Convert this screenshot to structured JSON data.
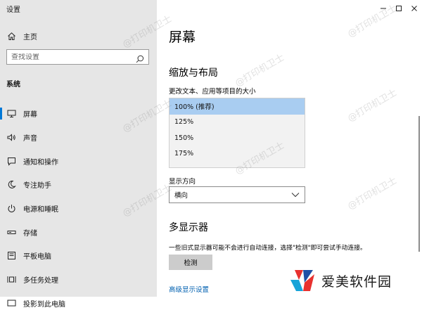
{
  "app_title": "设置",
  "sidebar": {
    "home_label": "主页",
    "search_placeholder": "查找设置",
    "section_label": "系统",
    "items": [
      {
        "label": "屏幕",
        "icon": "monitor-icon",
        "active": true
      },
      {
        "label": "声音",
        "icon": "speaker-icon",
        "active": false
      },
      {
        "label": "通知和操作",
        "icon": "notification-icon",
        "active": false
      },
      {
        "label": "专注助手",
        "icon": "moon-icon",
        "active": false
      },
      {
        "label": "电源和睡眠",
        "icon": "power-icon",
        "active": false
      },
      {
        "label": "存储",
        "icon": "storage-icon",
        "active": false
      },
      {
        "label": "平板电脑",
        "icon": "tablet-icon",
        "active": false
      },
      {
        "label": "多任务处理",
        "icon": "multitask-icon",
        "active": false
      },
      {
        "label": "投影到此电脑",
        "icon": "project-icon",
        "active": false
      }
    ]
  },
  "main": {
    "title": "屏幕",
    "scale_section": {
      "title": "缩放与布局",
      "field_label": "更改文本、应用等项目的大小",
      "options": [
        "100% (推荐)",
        "125%",
        "150%",
        "175%"
      ],
      "selected_index": 0
    },
    "orientation": {
      "label": "显示方向",
      "value": "横向"
    },
    "multi_display": {
      "title": "多显示器",
      "description": "一些旧式显示器可能不会进行自动连接，选择\"检测\"即可尝试手动连接。",
      "detect_button": "检测",
      "advanced_link": "高级显示设置"
    }
  },
  "watermark_text": "@打印机卫士",
  "logo_text": "爱美软件园",
  "colors": {
    "accent": "#0078d7",
    "sidebar_bg": "#e6e6e6",
    "selected_option": "#a9cdf1",
    "link": "#0060b0"
  }
}
